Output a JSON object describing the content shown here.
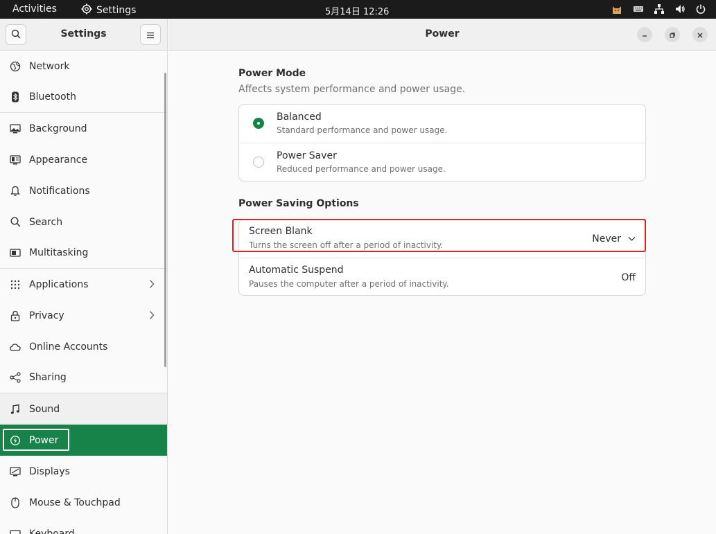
{
  "topbar": {
    "activities": "Activities",
    "app_name": "Settings",
    "clock": "5月14日  12:26"
  },
  "sidebar": {
    "title": "Settings",
    "items": [
      {
        "label": "Network",
        "icon": "network-icon"
      },
      {
        "label": "Bluetooth",
        "icon": "bluetooth-icon"
      },
      {
        "label": "Background",
        "icon": "background-icon"
      },
      {
        "label": "Appearance",
        "icon": "appearance-icon"
      },
      {
        "label": "Notifications",
        "icon": "bell-icon"
      },
      {
        "label": "Search",
        "icon": "search-icon"
      },
      {
        "label": "Multitasking",
        "icon": "multitasking-icon"
      },
      {
        "label": "Applications",
        "icon": "grid-icon"
      },
      {
        "label": "Privacy",
        "icon": "lock-icon"
      },
      {
        "label": "Online Accounts",
        "icon": "cloud-icon"
      },
      {
        "label": "Sharing",
        "icon": "share-icon"
      },
      {
        "label": "Sound",
        "icon": "music-note-icon"
      },
      {
        "label": "Power",
        "icon": "power-icon"
      },
      {
        "label": "Displays",
        "icon": "display-icon"
      },
      {
        "label": "Mouse & Touchpad",
        "icon": "mouse-icon"
      },
      {
        "label": "Keyboard",
        "icon": "keyboard-icon"
      }
    ],
    "active": "Power"
  },
  "main": {
    "title": "Power",
    "power_mode": {
      "title": "Power Mode",
      "subtitle": "Affects system performance and power usage.",
      "options": [
        {
          "label": "Balanced",
          "description": "Standard performance and power usage.",
          "selected": true
        },
        {
          "label": "Power Saver",
          "description": "Reduced performance and power usage.",
          "selected": false
        }
      ]
    },
    "power_saving": {
      "title": "Power Saving Options",
      "rows": [
        {
          "label": "Screen Blank",
          "description": "Turns the screen off after a period of inactivity.",
          "value": "Never"
        },
        {
          "label": "Automatic Suspend",
          "description": "Pauses the computer after a period of inactivity.",
          "value": "Off"
        }
      ]
    }
  },
  "colors": {
    "accent": "#188348",
    "highlight": "#e02020"
  }
}
